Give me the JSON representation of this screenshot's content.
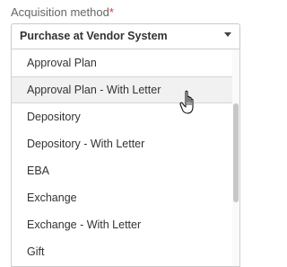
{
  "field": {
    "label": "Acquisition method",
    "required_mark": "*",
    "selected_value": "Purchase at Vendor System"
  },
  "menu": {
    "items": [
      {
        "label": "Approval Plan"
      },
      {
        "label": "Approval Plan - With Letter"
      },
      {
        "label": "Depository"
      },
      {
        "label": "Depository - With Letter"
      },
      {
        "label": "EBA"
      },
      {
        "label": "Exchange"
      },
      {
        "label": "Exchange - With Letter"
      },
      {
        "label": "Gift"
      }
    ],
    "hovered_index": 1
  },
  "icons": {
    "dropdown_caret": "chevron-down-icon",
    "pointer": "hand-cursor-icon"
  },
  "colors": {
    "required": "#d63b3b",
    "hover_bg": "#f1f1f1"
  }
}
